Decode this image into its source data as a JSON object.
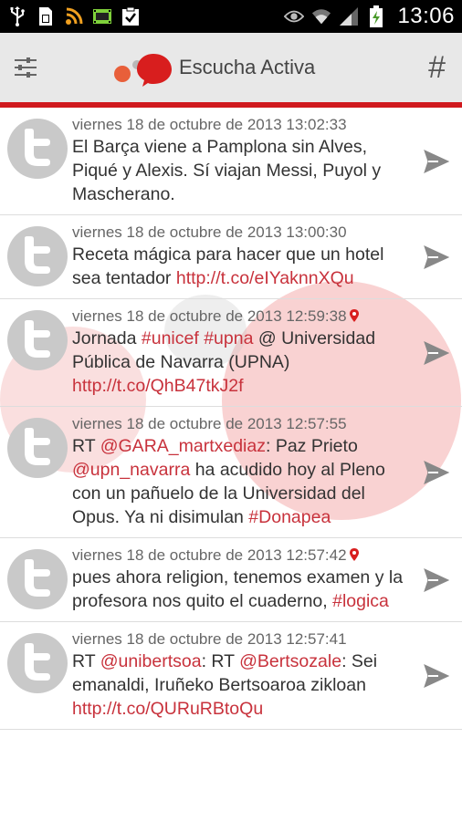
{
  "statusbar": {
    "icons": [
      "usb-icon",
      "sim-icon",
      "rss-icon",
      "film-icon",
      "clipboard-check-icon"
    ],
    "right_icons": [
      "eye-icon",
      "wifi-icon",
      "signal-icon",
      "battery-charging-icon"
    ],
    "time": "13:06"
  },
  "actionbar": {
    "title": "Escucha Activa",
    "hash": "#",
    "colors": {
      "accent": "#d0191e",
      "bar": "#e8e8e8"
    }
  },
  "feed": [
    {
      "date": "viernes 18 de octubre de 2013 13:02:33",
      "has_location": false,
      "segments": [
        {
          "t": "El Barça viene a Pamplona sin Alves, Piqué y Alexis. Sí viajan Messi, Puyol y Mascherano.",
          "link": false
        }
      ]
    },
    {
      "date": "viernes 18 de octubre de 2013 13:00:30",
      "has_location": false,
      "segments": [
        {
          "t": "Receta mágica para hacer que un hotel sea tentador ",
          "link": false
        },
        {
          "t": "http://t.co/eIYaknnXQu",
          "link": true
        }
      ]
    },
    {
      "date": "viernes 18 de octubre de 2013 12:59:38",
      "has_location": true,
      "segments": [
        {
          "t": "Jornada ",
          "link": false
        },
        {
          "t": "#unicef",
          "link": true
        },
        {
          "t": " ",
          "link": false
        },
        {
          "t": "#upna",
          "link": true
        },
        {
          "t": " @ Universidad Pública de Navarra (UPNA) ",
          "link": false
        },
        {
          "t": "http://t.co/QhB47tkJ2f",
          "link": true
        }
      ]
    },
    {
      "date": "viernes 18 de octubre de 2013 12:57:55",
      "has_location": false,
      "segments": [
        {
          "t": "RT ",
          "link": false
        },
        {
          "t": "@GARA_martxediaz",
          "link": true
        },
        {
          "t": ": Paz Prieto ",
          "link": false
        },
        {
          "t": "@upn_navarra",
          "link": true
        },
        {
          "t": " ha acudido hoy al Pleno con un pañuelo de la Universidad del Opus. Ya ni disimulan ",
          "link": false
        },
        {
          "t": "#Donapea",
          "link": true
        }
      ]
    },
    {
      "date": "viernes 18 de octubre de 2013 12:57:42",
      "has_location": true,
      "segments": [
        {
          "t": "pues ahora religion, tenemos examen y la profesora nos quito el cuaderno, ",
          "link": false
        },
        {
          "t": "#logica",
          "link": true
        }
      ]
    },
    {
      "date": "viernes 18 de octubre de 2013 12:57:41",
      "has_location": false,
      "segments": [
        {
          "t": "RT ",
          "link": false
        },
        {
          "t": "@unibertsoa",
          "link": true
        },
        {
          "t": ": RT ",
          "link": false
        },
        {
          "t": "@Bertsozale",
          "link": true
        },
        {
          "t": ": Sei emanaldi, Iruñeko Bertsoaroa zikloan ",
          "link": false
        },
        {
          "t": "http://t.co/QURuRBtoQu",
          "link": true
        }
      ]
    }
  ]
}
